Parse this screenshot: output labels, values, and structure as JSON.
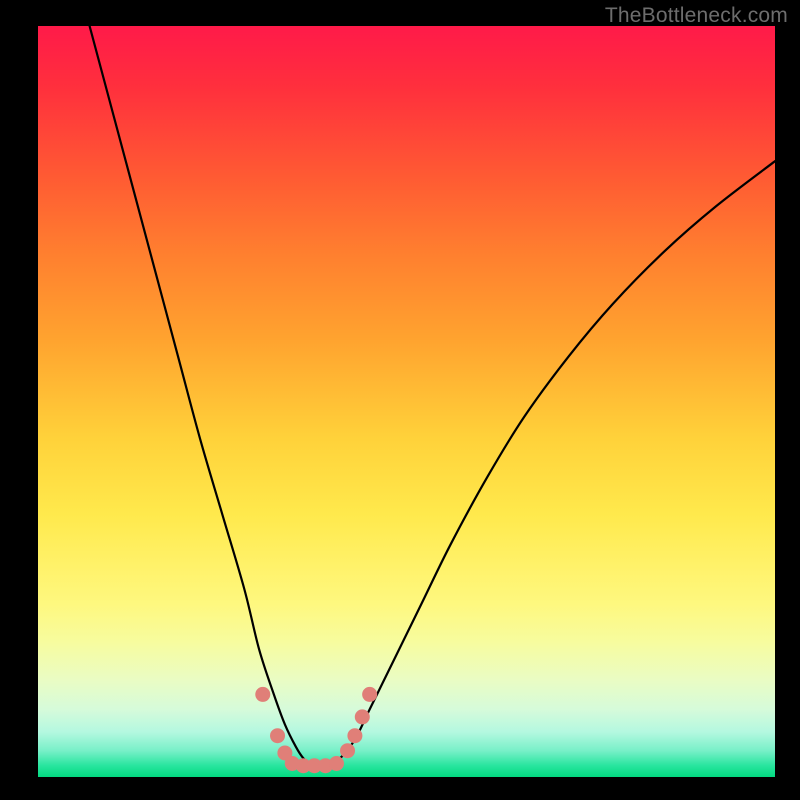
{
  "watermark": "TheBottleneck.com",
  "chart_data": {
    "type": "line",
    "title": "",
    "xlabel": "",
    "ylabel": "",
    "xlim": [
      0,
      100
    ],
    "ylim": [
      0,
      100
    ],
    "grid": false,
    "legend": false,
    "series": [
      {
        "name": "bottleneck-curve",
        "color": "#000000",
        "x": [
          7,
          10,
          13,
          16,
          19,
          22,
          25,
          28,
          30,
          32,
          33.5,
          35,
          36,
          37,
          38,
          39.5,
          41,
          43,
          45,
          48,
          52,
          56,
          61,
          66,
          72,
          78,
          85,
          92,
          100
        ],
        "y": [
          100,
          89,
          78,
          67,
          56,
          45,
          35,
          25,
          17,
          11,
          7,
          4,
          2.5,
          1.7,
          1.5,
          1.7,
          2.5,
          5,
          9,
          15,
          23,
          31,
          40,
          48,
          56,
          63,
          70,
          76,
          82
        ]
      }
    ],
    "markers": {
      "name": "valley-dots",
      "color": "#e07f78",
      "points": [
        {
          "x": 30.5,
          "y": 11
        },
        {
          "x": 32.5,
          "y": 5.5
        },
        {
          "x": 33.5,
          "y": 3.2
        },
        {
          "x": 34.5,
          "y": 1.8
        },
        {
          "x": 36,
          "y": 1.5
        },
        {
          "x": 37.5,
          "y": 1.5
        },
        {
          "x": 39,
          "y": 1.5
        },
        {
          "x": 40.5,
          "y": 1.8
        },
        {
          "x": 42,
          "y": 3.5
        },
        {
          "x": 43,
          "y": 5.5
        },
        {
          "x": 44,
          "y": 8
        },
        {
          "x": 45,
          "y": 11
        }
      ]
    },
    "gradient_stops": [
      {
        "pos": 0.0,
        "color": "#ff1a49"
      },
      {
        "pos": 0.5,
        "color": "#ffd23a"
      },
      {
        "pos": 0.8,
        "color": "#fef87f"
      },
      {
        "pos": 1.0,
        "color": "#02da80"
      }
    ]
  }
}
